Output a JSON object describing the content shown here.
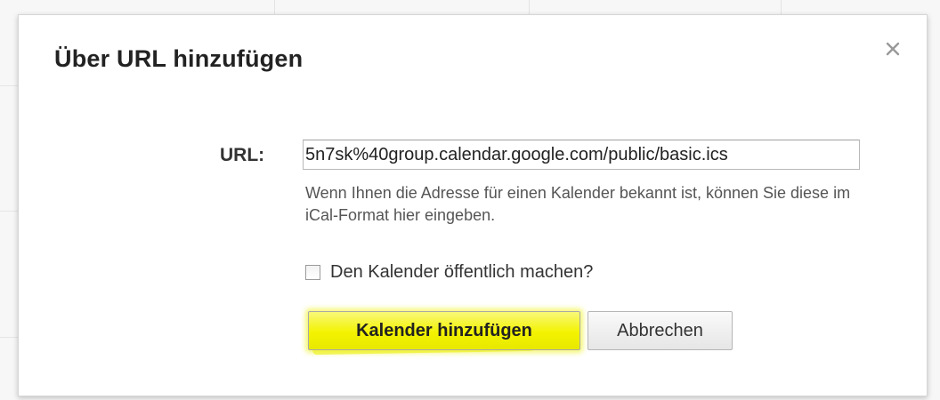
{
  "dialog": {
    "title": "Über URL hinzufügen",
    "close_label": "×"
  },
  "form": {
    "url_label": "URL:",
    "url_value": "5n7sk%40group.calendar.google.com/public/basic.ics",
    "help_text": "Wenn Ihnen die Adresse für einen Kalender bekannt ist, können Sie diese im iCal-Format hier eingeben.",
    "public_checkbox_label": "Den Kalender öffentlich machen?",
    "public_checkbox_checked": false
  },
  "actions": {
    "add_label": "Kalender hinzufügen",
    "cancel_label": "Abbrechen"
  },
  "colors": {
    "highlight": "#f3f300",
    "title_text": "#222222",
    "help_text": "#555555"
  },
  "icons": {
    "close": "close-icon"
  }
}
